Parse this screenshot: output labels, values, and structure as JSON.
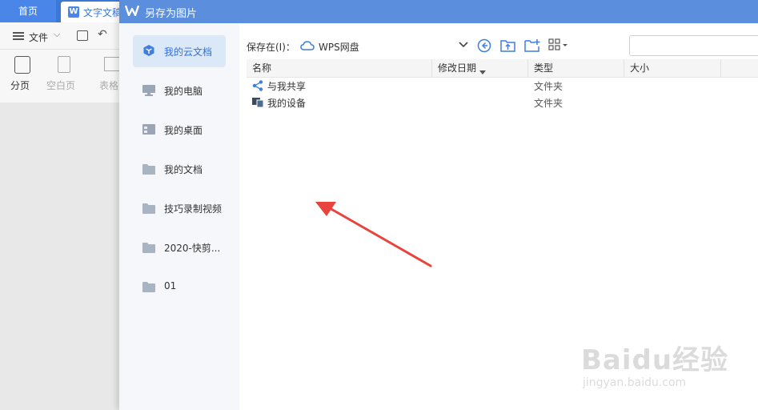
{
  "background_app": {
    "tabs": [
      {
        "label": "首页"
      },
      {
        "label": "文字文稿"
      }
    ],
    "ribbon": {
      "file_menu": "文件",
      "page_break": "分页",
      "blank_page": "空白页",
      "table": "表格"
    }
  },
  "dialog": {
    "title": "另存为图片",
    "sidebar": {
      "items": [
        {
          "label": "我的云文档",
          "icon": "cloud-cube-icon",
          "active": true
        },
        {
          "label": "我的电脑",
          "icon": "computer-icon"
        },
        {
          "label": "我的桌面",
          "icon": "desktop-icon"
        },
        {
          "label": "我的文档",
          "icon": "folder-icon"
        },
        {
          "label": "技巧录制视频",
          "icon": "folder-icon"
        },
        {
          "label": "2020-快剪...",
          "icon": "folder-icon"
        },
        {
          "label": "01",
          "icon": "folder-icon"
        }
      ]
    },
    "location": {
      "label": "保存在(I)：",
      "value": "WPS网盘"
    },
    "toolbar": {
      "icons": [
        "back-icon",
        "up-folder-icon",
        "new-folder-icon",
        "view-mode-icon"
      ]
    },
    "search": {
      "placeholder": ""
    },
    "columns": [
      "名称",
      "修改日期",
      "类型",
      "大小"
    ],
    "rows": [
      {
        "name": "与我共享",
        "type": "文件夹",
        "icon": "share-icon"
      },
      {
        "name": "我的设备",
        "type": "文件夹",
        "icon": "device-icon"
      }
    ]
  },
  "watermark": {
    "brand": "Baidu经验",
    "url": "jingyan.baidu.com"
  },
  "colors": {
    "accent": "#5b8fde",
    "sidebar_active": "#dbe8f8",
    "annotation_arrow": "#e8433c"
  }
}
